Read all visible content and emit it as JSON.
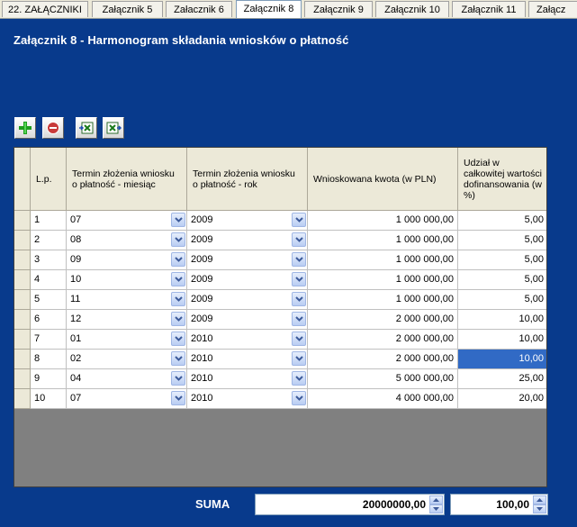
{
  "tabs": [
    "22. ZAŁĄCZNIKI",
    "Załącznik 5",
    "Załacznik 6",
    "Załącznik 8",
    "Załącznik 9",
    "Załącznik 10",
    "Załącznik 11",
    "Załącz"
  ],
  "active_tab": "Załącznik 8",
  "title": "Załącznik 8 - Harmonogram składania wniosków o płatność",
  "toolbar": {
    "icons": [
      "add-icon",
      "remove-icon",
      "export-excel-icon",
      "import-excel-icon"
    ]
  },
  "table": {
    "headers": [
      "L.p.",
      "Termin złożenia wniosku o płatność - miesiąc",
      "Termin złożenia wniosku o płatność - rok",
      "Wnioskowana kwota (w PLN)",
      "Udział w całkowitej wartości dofinansowania (w %)"
    ],
    "rows": [
      {
        "lp": "1",
        "month": "07",
        "year": "2009",
        "amount": "1 000 000,00",
        "share": "5,00"
      },
      {
        "lp": "2",
        "month": "08",
        "year": "2009",
        "amount": "1 000 000,00",
        "share": "5,00"
      },
      {
        "lp": "3",
        "month": "09",
        "year": "2009",
        "amount": "1 000 000,00",
        "share": "5,00"
      },
      {
        "lp": "4",
        "month": "10",
        "year": "2009",
        "amount": "1 000 000,00",
        "share": "5,00"
      },
      {
        "lp": "5",
        "month": "11",
        "year": "2009",
        "amount": "1 000 000,00",
        "share": "5,00"
      },
      {
        "lp": "6",
        "month": "12",
        "year": "2009",
        "amount": "2 000 000,00",
        "share": "10,00"
      },
      {
        "lp": "7",
        "month": "01",
        "year": "2010",
        "amount": "2 000 000,00",
        "share": "10,00"
      },
      {
        "lp": "8",
        "month": "02",
        "year": "2010",
        "amount": "2 000 000,00",
        "share": "10,00"
      },
      {
        "lp": "9",
        "month": "04",
        "year": "2010",
        "amount": "5 000 000,00",
        "share": "25,00"
      },
      {
        "lp": "10",
        "month": "07",
        "year": "2010",
        "amount": "4 000 000,00",
        "share": "20,00"
      }
    ],
    "selected_row": 8
  },
  "footer": {
    "suma_label": "SUMA",
    "total_amount": "20000000,00",
    "total_share": "100,00"
  },
  "colors": {
    "background": "#083a8c",
    "selection": "#316ac5"
  }
}
